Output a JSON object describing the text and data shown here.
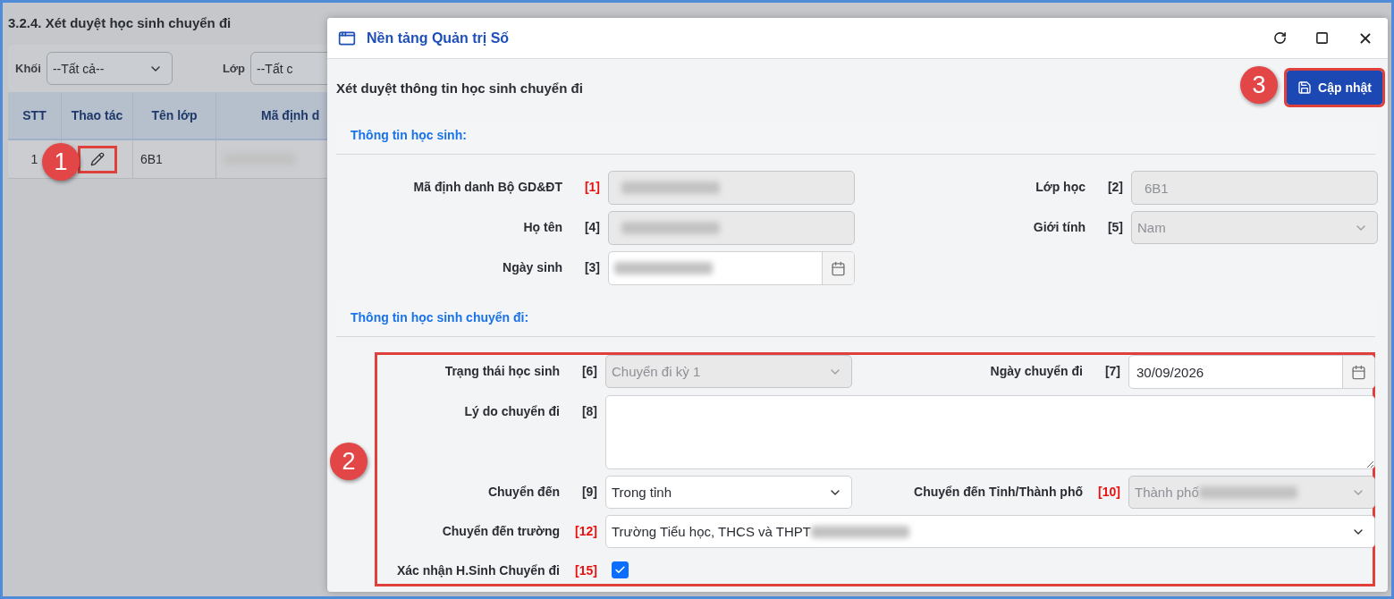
{
  "page": {
    "title": "3.2.4. Xét duyệt học sinh chuyển đi",
    "filters": [
      {
        "label": "Khối",
        "value": "--Tất cả--"
      },
      {
        "label": "Lớp",
        "value": "--Tất c"
      }
    ],
    "table": {
      "columns": [
        "STT",
        "Thao tác",
        "Tên lớp",
        "Mã định d"
      ],
      "rows": [
        {
          "stt": "1",
          "class_name": "6B1",
          "code_redacted": true,
          "edit_highlighted": true
        }
      ]
    }
  },
  "dialog": {
    "title": "Nền tảng Quản trị Số",
    "heading": "Xét duyệt thông tin học sinh chuyển đi",
    "update_button": {
      "label": "Cập nhật",
      "highlighted": true
    },
    "sections": [
      {
        "title": "Thông tin học sinh:",
        "highlighted": false,
        "rows": [
          [
            {
              "kind": "text",
              "label": "Mã định danh Bộ GD&ĐT",
              "marker": "[1]",
              "required": true,
              "disabled": true,
              "redacted": true,
              "wide": false
            },
            {
              "kind": "text",
              "label": "Lớp học",
              "marker": "[2]",
              "required": false,
              "disabled": true,
              "value": "6B1",
              "redacted": false,
              "wide": false
            }
          ],
          [
            {
              "kind": "text",
              "label": "Họ tên",
              "marker": "[4]",
              "required": false,
              "disabled": true,
              "redacted": true,
              "wide": false
            },
            {
              "kind": "select",
              "label": "Giới tính",
              "marker": "[5]",
              "required": false,
              "disabled": true,
              "value": "Nam",
              "redacted": false,
              "wide": false
            }
          ],
          [
            {
              "kind": "date",
              "label": "Ngày sinh",
              "marker": "[3]",
              "required": false,
              "disabled": false,
              "redacted": true,
              "wide": false
            }
          ]
        ]
      },
      {
        "title": "Thông tin học sinh chuyển đi:",
        "highlighted": true,
        "rows": [
          [
            {
              "kind": "select",
              "label": "Trạng thái học sinh",
              "marker": "[6]",
              "required": false,
              "disabled": true,
              "value": "Chuyển đi kỳ 1",
              "redacted": false,
              "wide": false
            },
            {
              "kind": "date",
              "label": "Ngày chuyển đi",
              "marker": "[7]",
              "required": false,
              "disabled": false,
              "value": "30/09/2026",
              "redacted": false,
              "wide": false
            }
          ],
          [
            {
              "kind": "textarea",
              "label": "Lý do chuyển đi",
              "marker": "[8]",
              "required": false,
              "wide": true
            }
          ],
          [
            {
              "kind": "select",
              "label": "Chuyển đến",
              "marker": "[9]",
              "required": false,
              "disabled": false,
              "value": "Trong tỉnh",
              "redacted": false,
              "wide": false
            },
            {
              "kind": "select",
              "label": "Chuyển đến Tỉnh/Thành phố",
              "marker": "[10]",
              "required": true,
              "disabled": true,
              "value": "Thành phố",
              "redacted": true,
              "wide": false
            }
          ],
          [
            {
              "kind": "select",
              "label": "Chuyển đến trường",
              "marker": "[12]",
              "required": true,
              "disabled": false,
              "value": "Trường Tiểu học, THCS và THPT",
              "redacted": true,
              "wide": true
            }
          ],
          [
            {
              "kind": "checkbox",
              "label": "Xác nhận H.Sinh Chuyển đi",
              "marker": "[15]",
              "required": true,
              "checked": true
            }
          ]
        ]
      }
    ]
  },
  "annotations": [
    {
      "label": "1"
    },
    {
      "label": "2"
    },
    {
      "label": "3"
    }
  ]
}
